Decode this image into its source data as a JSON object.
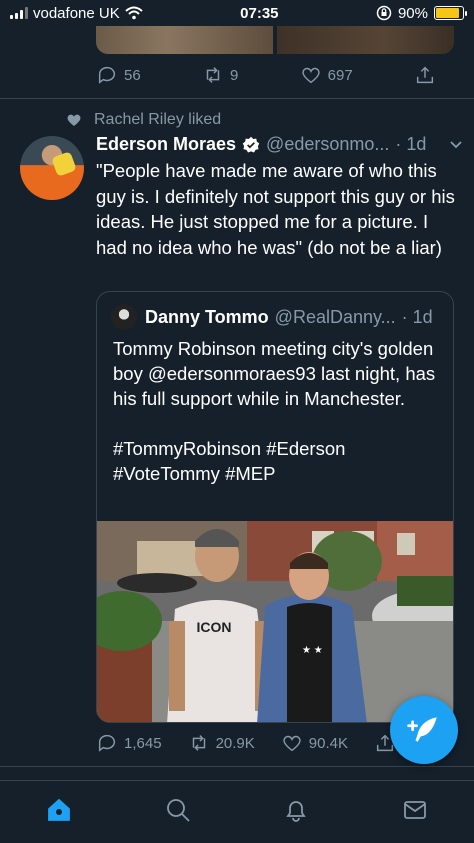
{
  "status_bar": {
    "carrier": "vodafone UK",
    "time": "07:35",
    "battery": "90%"
  },
  "previous_tweet": {
    "replies": "56",
    "retweets": "9",
    "likes": "697"
  },
  "liked_by": "Rachel Riley liked",
  "tweet": {
    "name": "Ederson Moraes",
    "handle": "@edersonmo...",
    "age": "· 1d",
    "text": "\"People have made me aware of who this guy is. I definitely not support this guy or his ideas. He just stopped me for a picture. I had no idea who he was\" (do not be a liar)",
    "replies": "1,645",
    "retweets": "20.9K",
    "likes": "90.4K"
  },
  "quoted_tweet": {
    "name": "Danny Tommo",
    "handle": "@RealDanny...",
    "age": "· 1d",
    "text": "Tommy Robinson meeting city's golden boy @edersonmoraes93 last night, has his full support while in Manchester.\n\n#TommyRobinson #Ederson\n#VoteTommy #MEP",
    "photo_shirt_text": "ICON"
  },
  "tabbar": {
    "items": [
      "home-icon",
      "search-icon",
      "bell-icon",
      "mail-icon"
    ],
    "active": "home"
  },
  "colors": {
    "background": "#15202b",
    "accent": "#1da1f2",
    "muted": "#8899a6",
    "border": "#38444d"
  }
}
